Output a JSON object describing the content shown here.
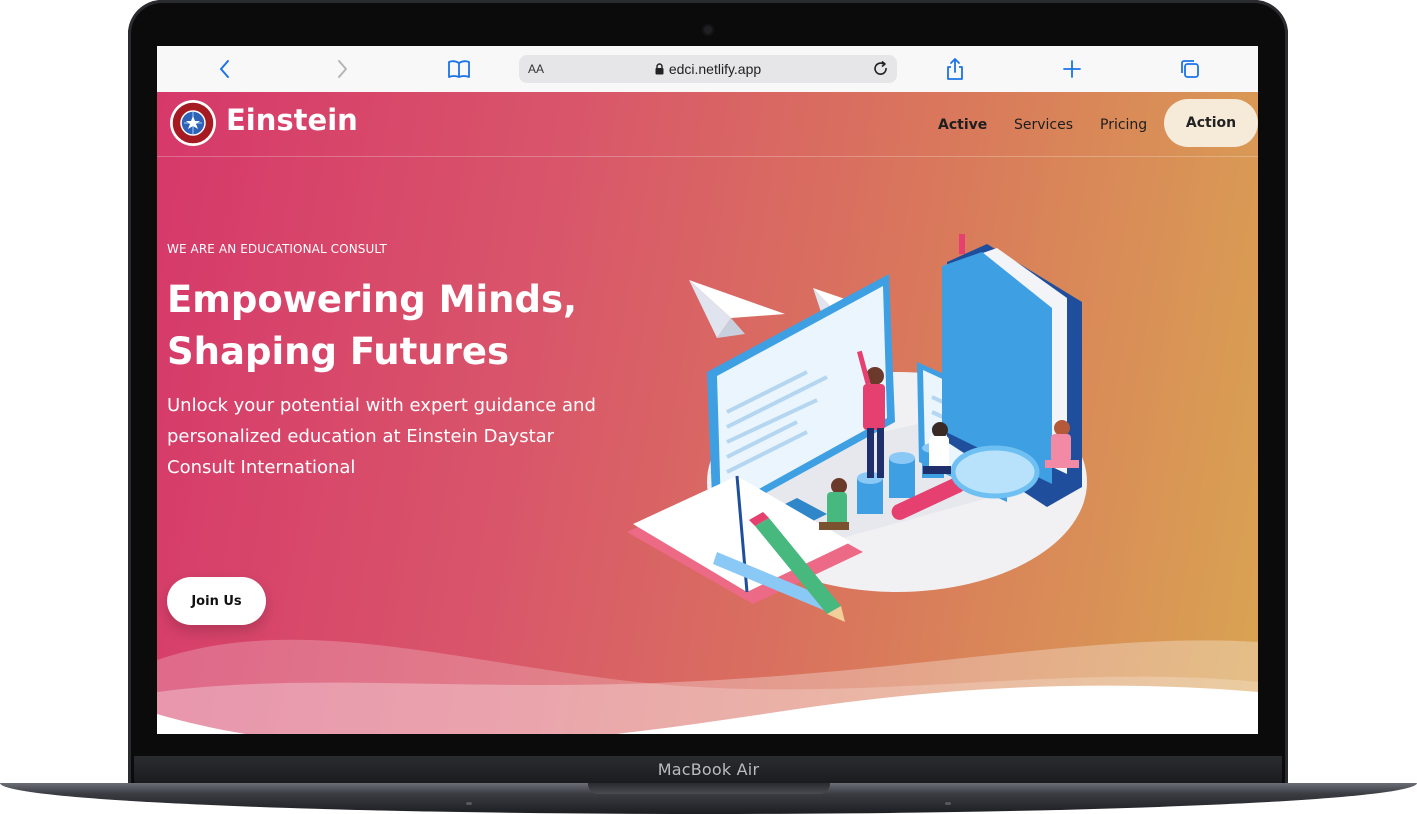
{
  "device": {
    "label": "MacBook Air"
  },
  "browser": {
    "address_prefix": "AA",
    "url": "edci.netlify.app",
    "icons": [
      "back-icon",
      "forward-icon",
      "bookmarks-icon",
      "lock-icon",
      "reload-icon",
      "share-icon",
      "new-tab-icon",
      "tabs-icon"
    ]
  },
  "site": {
    "logo_text": "Einstein",
    "nav": {
      "links": [
        "Active",
        "Services",
        "Pricing"
      ],
      "action": "Action"
    },
    "hero": {
      "eyebrow": "WE ARE AN EDUCATIONAL CONSULT",
      "title_line1": "Empowering Minds,",
      "title_line2": "Shaping Futures",
      "subtitle": "Unlock your potential with expert guidance and personalized education at Einstein Daystar Consult International",
      "cta": "Join Us"
    },
    "colors": {
      "gradient_start": "#d6386a",
      "gradient_end": "#d9a452",
      "action_bg": "#f6ead9",
      "logo_red": "#a61b22"
    }
  }
}
